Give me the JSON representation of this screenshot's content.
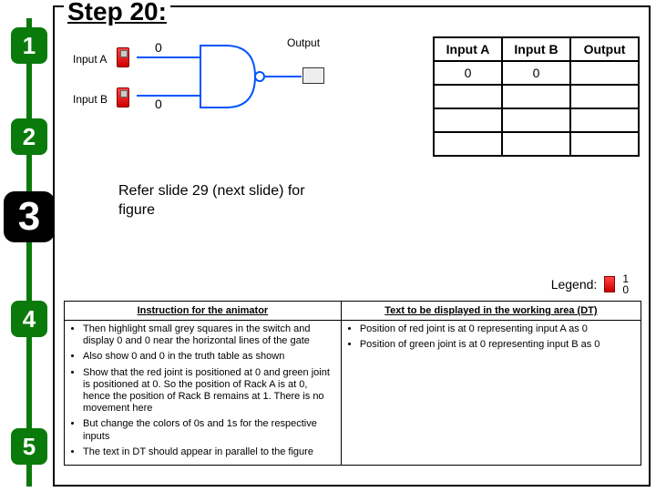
{
  "title": "Step 20:",
  "steps": [
    "1",
    "2",
    "3",
    "4",
    "5"
  ],
  "active_step_index": 2,
  "circuit": {
    "inputA_label": "Input A",
    "inputB_label": "Input B",
    "valueA": "0",
    "valueB": "0",
    "output_label": "Output"
  },
  "truth_table": {
    "headers": [
      "Input A",
      "Input B",
      "Output"
    ],
    "rows": [
      [
        "0",
        "0",
        ""
      ],
      [
        "",
        "",
        ""
      ],
      [
        "",
        "",
        ""
      ],
      [
        "",
        "",
        ""
      ]
    ]
  },
  "refer_note": "Refer slide 29 (next slide) for figure",
  "legend": {
    "label": "Legend:",
    "one": "1",
    "zero": "0"
  },
  "instr": {
    "left_header": "Instruction for the animator",
    "right_header": "Text to be displayed in the working area (DT)",
    "left_items": [
      "Then highlight small grey squares in the switch and display 0 and 0 near the horizontal lines of the gate",
      "Also show 0 and 0 in the truth table as shown",
      "Show that the red joint is positioned at 0 and green joint is positioned at 0. So the position of Rack A is at 0, hence the position of Rack B remains at 1. There is no movement here",
      "But change the colors of 0s and 1s for the respective inputs",
      "The text in DT should appear in parallel to the figure"
    ],
    "right_items": [
      "Position of red joint is at 0 representing input A as 0",
      "Position of green joint is at 0 representing input B as 0"
    ]
  }
}
